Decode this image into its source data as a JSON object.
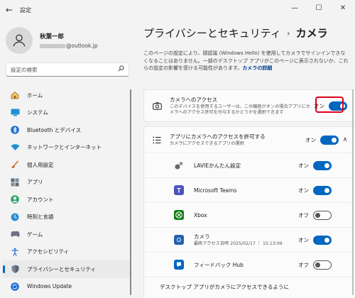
{
  "window": {
    "title": "設定",
    "back_glyph": "←",
    "minimize_glyph": "—",
    "maximize_glyph": "☐",
    "close_glyph": "✕"
  },
  "profile": {
    "name": "秋葉一郎",
    "email_domain": "@outlook.jp"
  },
  "search": {
    "placeholder": "設定の検索"
  },
  "sidebar": {
    "items": [
      {
        "label": "ホーム",
        "icon": "home-icon",
        "active": false
      },
      {
        "label": "システム",
        "icon": "system-icon",
        "active": false
      },
      {
        "label": "Bluetooth とデバイス",
        "icon": "bluetooth-icon",
        "active": false
      },
      {
        "label": "ネットワークとインターネット",
        "icon": "wifi-icon",
        "active": false
      },
      {
        "label": "個人用設定",
        "icon": "brush-icon",
        "active": false
      },
      {
        "label": "アプリ",
        "icon": "apps-icon",
        "active": false
      },
      {
        "label": "アカウント",
        "icon": "account-icon",
        "active": false
      },
      {
        "label": "時刻と言語",
        "icon": "globe-clock-icon",
        "active": false
      },
      {
        "label": "ゲーム",
        "icon": "gamepad-icon",
        "active": false
      },
      {
        "label": "アクセシビリティ",
        "icon": "accessibility-icon",
        "active": false
      },
      {
        "label": "プライバシーとセキュリティ",
        "icon": "shield-icon",
        "active": true
      },
      {
        "label": "Windows Update",
        "icon": "update-icon",
        "active": false
      }
    ]
  },
  "breadcrumb": {
    "parent": "プライバシーとセキュリティ",
    "separator": "›",
    "current": "カメラ"
  },
  "description": {
    "text": "このページの設定により、顔認識 (Windows Hello) を使用してカメラでサインインできなくなることはありません。一部のデスクトップ アプリがこのページに表示されないか、これらの設定の影響を受ける可能性があります。",
    "link": "カメラの詳細"
  },
  "camera_access": {
    "title": "カメラへのアクセス",
    "subtitle": "このデバイスを使用するユーザーは、この機能がオンの場合アプリにカメラへのアクセス許可を付与するかどうかを選択できます",
    "state_label": "オン",
    "on": true
  },
  "app_access": {
    "title": "アプリにカメラへのアクセスを許可する",
    "subtitle": "カメラにアクセスできるアプリの選択",
    "state_label": "オン",
    "on": true,
    "chevron": "∧"
  },
  "apps": [
    {
      "name": "LAVIEかんたん設定",
      "sub": "",
      "state_label": "オン",
      "on": true,
      "icon": "lavie-icon",
      "color": "#ffffff"
    },
    {
      "name": "Microsoft Teams",
      "sub": "",
      "state_label": "オン",
      "on": true,
      "icon": "teams-icon",
      "color": "#4b53bc"
    },
    {
      "name": "Xbox",
      "sub": "",
      "state_label": "オフ",
      "on": false,
      "icon": "xbox-icon",
      "color": "#107c10"
    },
    {
      "name": "カメラ",
      "sub": "最終アクセス日時 2025/02/17 ｜ 15:13:09",
      "state_label": "オン",
      "on": true,
      "icon": "camera-app-icon",
      "color": "#2b5fa8"
    },
    {
      "name": "フィードバック Hub",
      "sub": "",
      "state_label": "オフ",
      "on": false,
      "icon": "feedback-hub-icon",
      "color": "#0067c0"
    }
  ],
  "desktop_apps": {
    "title": "デスクトップ アプリがカメラにアクセスできるように"
  },
  "colors": {
    "accent": "#0067c0",
    "highlight": "#e0001b"
  }
}
